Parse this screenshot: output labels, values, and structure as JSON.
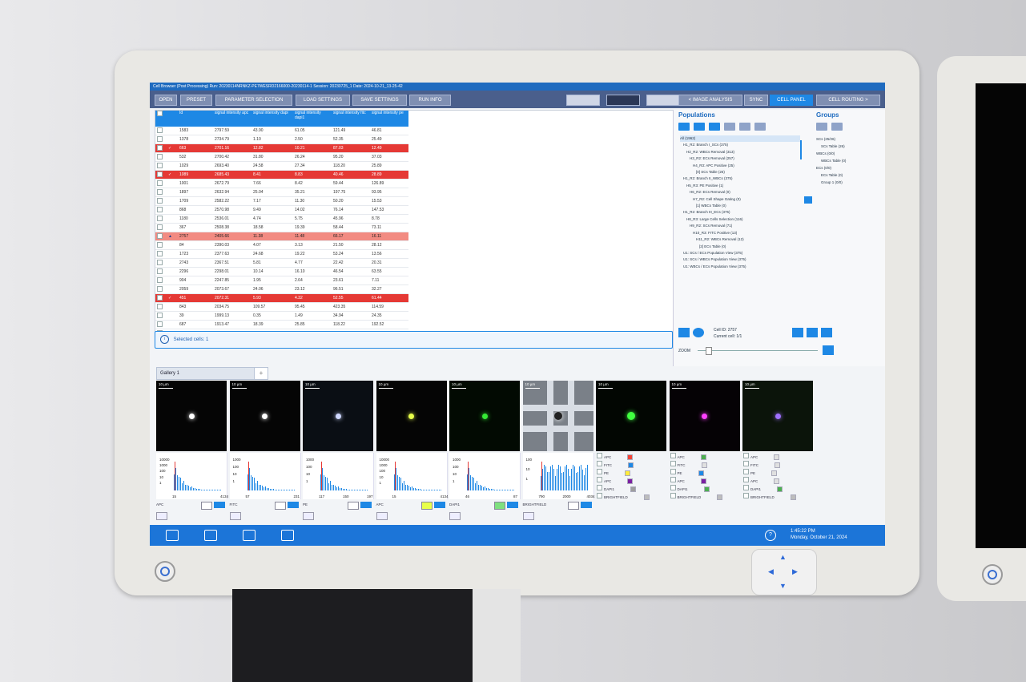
{
  "window": {
    "title": "Cell Browser (Post Processing) Run: 20230114NRNKZ-PE7WESRD2166000-20230114-1 Session: 20230725_1 Date: 2024-10-21_13-25-42"
  },
  "toolbar": {
    "open": "OPEN",
    "preset": "PRESET",
    "parameter_selection": "PARAMETER SELECTION",
    "load_settings": "LOAD SETTINGS",
    "save_settings": "SAVE SETTINGS",
    "run_info": "RUN INFO",
    "image_analysis": "< IMAGE ANALYSIS",
    "sync": "SYNC",
    "cell_panel": "CELL PANEL",
    "cell_routing": "CELL ROUTING >"
  },
  "table": {
    "headers": [
      "Id",
      "signal intensity apc",
      "signal intensity dapi",
      "signal intensity dapi1",
      "signal intensity fitc",
      "signal intensity pe"
    ],
    "rows": [
      {
        "id": "1583",
        "apc": "2797.59",
        "dapi": "43.90",
        "dapi1": "61.05",
        "fitc": "121.49",
        "pe": "46.81",
        "state": ""
      },
      {
        "id": "1378",
        "apc": "2734.79",
        "dapi": "1.10",
        "dapi1": "2.50",
        "fitc": "52.35",
        "pe": "25.49",
        "state": ""
      },
      {
        "id": "663",
        "apc": "2701.16",
        "dapi": "12.82",
        "dapi1": "10.21",
        "fitc": "87.03",
        "pe": "12.49",
        "state": "selected"
      },
      {
        "id": "532",
        "apc": "2700.42",
        "dapi": "31.80",
        "dapi1": "26.24",
        "fitc": "95.20",
        "pe": "37.03",
        "state": ""
      },
      {
        "id": "1029",
        "apc": "2693.40",
        "dapi": "24.58",
        "dapi1": "27.34",
        "fitc": "118.20",
        "pe": "25.89",
        "state": ""
      },
      {
        "id": "1089",
        "apc": "2685.43",
        "dapi": "8.41",
        "dapi1": "8.83",
        "fitc": "40.46",
        "pe": "28.89",
        "state": "selected"
      },
      {
        "id": "1001",
        "apc": "2672.79",
        "dapi": "7.66",
        "dapi1": "8.42",
        "fitc": "59.44",
        "pe": "126.89",
        "state": ""
      },
      {
        "id": "1897",
        "apc": "2632.94",
        "dapi": "25.04",
        "dapi1": "35.21",
        "fitc": "197.75",
        "pe": "93.95",
        "state": ""
      },
      {
        "id": "1709",
        "apc": "2582.22",
        "dapi": "7.17",
        "dapi1": "11.30",
        "fitc": "50.20",
        "pe": "15.53",
        "state": ""
      },
      {
        "id": "868",
        "apc": "2570.98",
        "dapi": "9.49",
        "dapi1": "14.02",
        "fitc": "76.14",
        "pe": "147.53",
        "state": ""
      },
      {
        "id": "1180",
        "apc": "2536.01",
        "dapi": "4.74",
        "dapi1": "5.75",
        "fitc": "45.96",
        "pe": "8.78",
        "state": ""
      },
      {
        "id": "367",
        "apc": "2508.38",
        "dapi": "18.58",
        "dapi1": "19.39",
        "fitc": "58.44",
        "pe": "73.11",
        "state": ""
      },
      {
        "id": "2757",
        "apc": "2405.66",
        "dapi": "11.38",
        "dapi1": "11.48",
        "fitc": "66.17",
        "pe": "16.11",
        "state": "current"
      },
      {
        "id": "84",
        "apc": "2390.03",
        "dapi": "4.07",
        "dapi1": "3.13",
        "fitc": "21.50",
        "pe": "28.12",
        "state": ""
      },
      {
        "id": "1723",
        "apc": "2377.63",
        "dapi": "24.68",
        "dapi1": "19.22",
        "fitc": "53.24",
        "pe": "13.56",
        "state": ""
      },
      {
        "id": "2743",
        "apc": "2367.51",
        "dapi": "5.81",
        "dapi1": "4.77",
        "fitc": "22.42",
        "pe": "20.31",
        "state": ""
      },
      {
        "id": "2296",
        "apc": "2298.01",
        "dapi": "10.14",
        "dapi1": "16.10",
        "fitc": "46.54",
        "pe": "63.55",
        "state": ""
      },
      {
        "id": "904",
        "apc": "2247.85",
        "dapi": "1.95",
        "dapi1": "2.64",
        "fitc": "23.61",
        "pe": "7.11",
        "state": ""
      },
      {
        "id": "2059",
        "apc": "2073.67",
        "dapi": "24.06",
        "dapi1": "23.12",
        "fitc": "96.51",
        "pe": "32.27",
        "state": ""
      },
      {
        "id": "451",
        "apc": "2072.31",
        "dapi": "5.93",
        "dapi1": "4.32",
        "fitc": "52.55",
        "pe": "61.44",
        "state": "selected"
      },
      {
        "id": "843",
        "apc": "2034.75",
        "dapi": "109.57",
        "dapi1": "95.45",
        "fitc": "423.35",
        "pe": "114.59",
        "state": ""
      },
      {
        "id": "39",
        "apc": "1999.13",
        "dapi": "0.35",
        "dapi1": "1.49",
        "fitc": "34.94",
        "pe": "24.35",
        "state": ""
      },
      {
        "id": "687",
        "apc": "1913.47",
        "dapi": "18.39",
        "dapi1": "25.85",
        "fitc": "118.22",
        "pe": "192.52",
        "state": ""
      },
      {
        "id": "1530",
        "apc": "1904.37",
        "dapi": "187.95",
        "dapi1": "195.54",
        "fitc": "227.63",
        "pe": "48.10",
        "state": ""
      }
    ]
  },
  "status": {
    "selected_cells": "Selected cells: 1"
  },
  "populations": {
    "title": "Populations",
    "tree": [
      "All (1962)",
      "H1_R2: Branch I_SCs (375)",
      "H2_R2: WBCs Removal (313)",
      "H3_R2: ECs Removal (257)",
      "H4_R3: APC Positive (25)",
      "[0] SCs Table (26)",
      "H1_R2: Branch II_WBCs (375)",
      "H5_R3: PE Positive (1)",
      "H6_R2: ECs Removal (0)",
      "H7_R2: Cell Shape Gating (0)",
      "[1] WBCs Table (0)",
      "H1_R2: Branch III_ECs (375)",
      "H8_R3: Large Cells Selection (116)",
      "H9_R2: SCs Removal (71)",
      "H10_R3: FITC Positive (13)",
      "H11_R2: WBCs Removal (12)",
      "[2] ECs Table (0)",
      "U1: SCs / ECs Population View (375)",
      "U1: SCs / WBCs Population View (375)",
      "U1: WBCs / ECs Population View (375)"
    ]
  },
  "groups": {
    "title": "Groups",
    "items": [
      "SCs (25/26)",
      "SCs Table (26)",
      "WBCs (0/0)",
      "WBCs Table (0)",
      "ECs (0/0)",
      "ECs Table (0)",
      "Group 1 (0/0)"
    ]
  },
  "cell_info": {
    "cell_id": "Cell ID: 2757",
    "current": "Current cell: 1/1",
    "zoom": "ZOOM"
  },
  "gallery": {
    "tab": "Gallery 1",
    "add": "+",
    "scale": "10 µm",
    "histograms": [
      {
        "y": [
          "10000",
          "1000",
          "100",
          "10",
          "1"
        ],
        "x": [
          "15",
          "4134"
        ]
      },
      {
        "y": [
          "1000",
          "100",
          "10",
          "1"
        ],
        "x": [
          "57",
          "231"
        ]
      },
      {
        "y": [
          "1000",
          "100",
          "10",
          "1"
        ],
        "x": [
          "117",
          "150",
          "197"
        ]
      },
      {
        "y": [
          "10000",
          "1000",
          "100",
          "10",
          "1"
        ],
        "x": [
          "15",
          "4134"
        ]
      },
      {
        "y": [
          "1000",
          "100",
          "10",
          "1"
        ],
        "x": [
          "46",
          "87"
        ]
      },
      {
        "y": [
          "100",
          "10",
          "1"
        ],
        "x": [
          "790",
          "2000",
          "4034"
        ]
      }
    ],
    "channel_labels": [
      "APC",
      "FITC",
      "PE",
      "APC",
      "DAPI1",
      "BRIGHTFIELD"
    ],
    "channel_list": [
      "APC",
      "FITC",
      "PE",
      "APC",
      "DAPI1",
      "BRIGHTFIELD"
    ],
    "bottom_labels": [
      "APC",
      "FITC",
      "PE",
      "APC",
      "DAPI1",
      "BRIGHTFIELD"
    ]
  },
  "clock": {
    "time": "1:45:22 PM",
    "date": "Monday, October 21, 2024"
  },
  "colors": {
    "accent": "#1e88e5",
    "highlight": "#e53935",
    "taskbar": "#1c75d8"
  }
}
